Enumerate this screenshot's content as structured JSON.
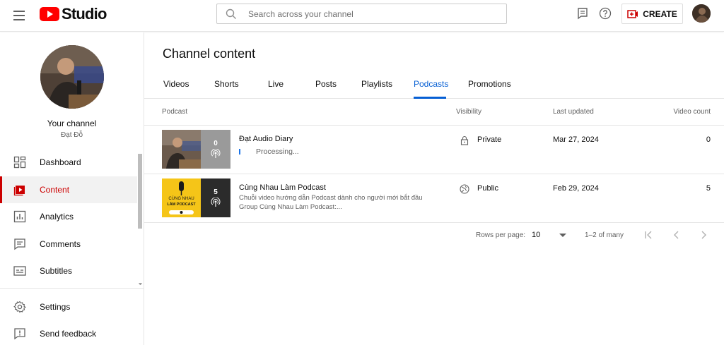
{
  "header": {
    "logo_text": "Studio",
    "search_placeholder": "Search across your channel",
    "create_label": "CREATE",
    "icons": [
      "menu-icon",
      "search-icon",
      "feedback-icon",
      "help-icon",
      "create-icon",
      "avatar"
    ],
    "brand_color": "#ff0000"
  },
  "sidebar": {
    "your_channel": "Your channel",
    "channel_name": "Đạt Đỗ",
    "items": [
      {
        "label": "Dashboard",
        "icon": "dashboard-icon"
      },
      {
        "label": "Content",
        "icon": "content-icon",
        "active": true
      },
      {
        "label": "Analytics",
        "icon": "analytics-icon"
      },
      {
        "label": "Comments",
        "icon": "comments-icon"
      },
      {
        "label": "Subtitles",
        "icon": "subtitles-icon"
      }
    ],
    "bottom_items": [
      {
        "label": "Settings",
        "icon": "settings-icon"
      },
      {
        "label": "Send feedback",
        "icon": "feedback-icon"
      }
    ],
    "active_color": "#cc0000"
  },
  "main": {
    "title": "Channel content",
    "tabs": [
      "Videos",
      "Shorts",
      "Live",
      "Posts",
      "Playlists",
      "Podcasts",
      "Promotions"
    ],
    "active_tab": "Podcasts",
    "active_tab_color": "#065fd4",
    "columns": {
      "podcast": "Podcast",
      "visibility": "Visibility",
      "last_updated": "Last updated",
      "video_count": "Video count"
    },
    "rows": [
      {
        "title": "Đạt Audio Diary",
        "status": "Processing...",
        "visibility": "Private",
        "visibility_icon": "lock-icon",
        "last_updated": "Mar 27, 2024",
        "video_count": "0",
        "thumb_count": "0"
      },
      {
        "title": "Cùng Nhau Làm Podcast",
        "description_line1": "Chuỗi video hướng dẫn Podcast dành cho người mới bắt đầu",
        "description_line2": "Group Cùng Nhau Làm Podcast:...",
        "visibility": "Public",
        "visibility_icon": "globe-icon",
        "last_updated": "Feb 29, 2024",
        "video_count": "5",
        "thumb_count": "5",
        "thumb_text_1": "CÙNG NHAU",
        "thumb_text_2": "LÀM PODCAST"
      }
    ],
    "pagination": {
      "rows_per_page_label": "Rows per page:",
      "rows_per_page": "10",
      "range": "1–2 of many"
    }
  }
}
